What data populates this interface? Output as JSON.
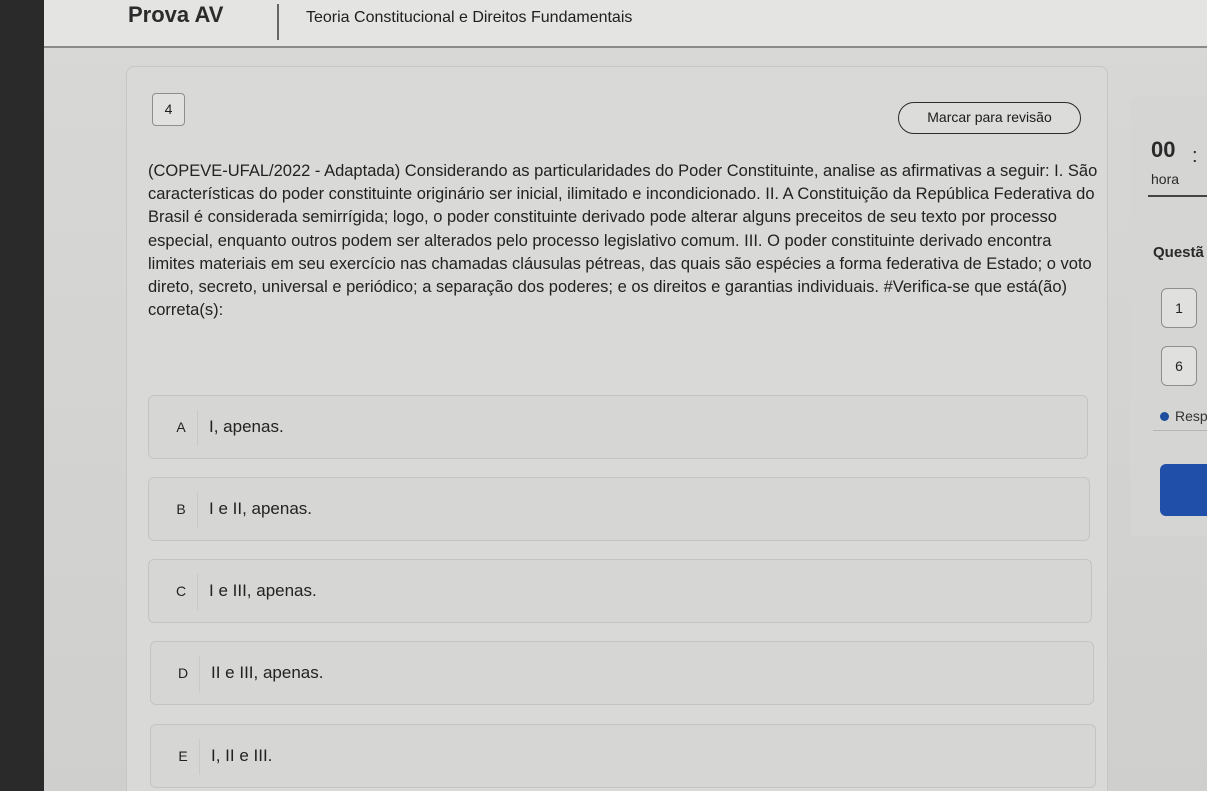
{
  "header": {
    "app_title": "Prova AV",
    "course_title": "Teoria Constitucional e Direitos Fundamentais"
  },
  "question": {
    "number": "4",
    "review_label": "Marcar para revisão",
    "text": "(COPEVE-UFAL/2022 - Adaptada) Considerando as particularidades do Poder Constituinte, analise as afirmativas a seguir: I. São características do poder constituinte originário ser inicial, ilimitado e incondicionado. II. A Constituição da República Federativa do Brasil é considerada semirrígida; logo, o poder constituinte derivado pode alterar alguns preceitos de seu texto por processo especial, enquanto outros podem ser alterados pelo processo legislativo comum. III. O poder constituinte derivado encontra limites materiais em seu exercício nas chamadas cláusulas pétreas, das quais são espécies a forma federativa de Estado; o voto direto, secreto, universal e periódico; a separação dos poderes; e os direitos e garantias individuais.   #Verifica-se que está(ão) correta(s):",
    "options": [
      {
        "letter": "A",
        "text": "I, apenas."
      },
      {
        "letter": "B",
        "text": "I e II, apenas."
      },
      {
        "letter": "C",
        "text": "I e III, apenas."
      },
      {
        "letter": "D",
        "text": "II e III, apenas."
      },
      {
        "letter": "E",
        "text": "I, II e III."
      }
    ]
  },
  "sidebar": {
    "timer_value": "00",
    "timer_separator": ":",
    "timer_unit": "hora",
    "questions_label": "Questã",
    "question_nav": [
      "1",
      "6"
    ],
    "legend_label": "Resp",
    "legend_color": "#1e4f9e",
    "accent_color": "#1f4fa8"
  }
}
